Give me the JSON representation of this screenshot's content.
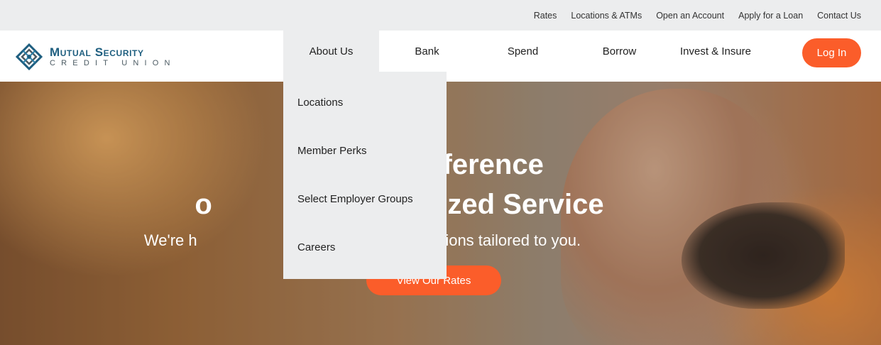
{
  "utility_nav": {
    "links": [
      "Rates",
      "Locations & ATMs",
      "Open an Account",
      "Apply for a Loan",
      "Contact Us"
    ]
  },
  "logo": {
    "line1": "Mutual Security",
    "line2": "CREDIT UNION",
    "colors": {
      "primary": "#1e5e7f",
      "accent": "#2a7fa8",
      "gray": "#4c5b63"
    },
    "icon": "diamond-logo-icon"
  },
  "main_nav": {
    "items": [
      "About Us",
      "Bank",
      "Spend",
      "Borrow",
      "Invest & Insure"
    ],
    "active": "About Us",
    "login_label": "Log In"
  },
  "dropdown": {
    "items": [
      "Locations",
      "Member Perks",
      "Select Employer Groups",
      "Careers"
    ]
  },
  "hero": {
    "title_line1_visible": "fference",
    "title_line2_part1": "o",
    "title_line2_part2": "zed Service",
    "subtitle_part1": "We're h",
    "subtitle_part2": "al solutions tailored to you.",
    "cta_label": "View Our Rates"
  },
  "colors": {
    "brand_orange": "#fb5d2a",
    "utility_bar_bg": "#ecedee",
    "dropdown_bg": "#ecedee"
  }
}
